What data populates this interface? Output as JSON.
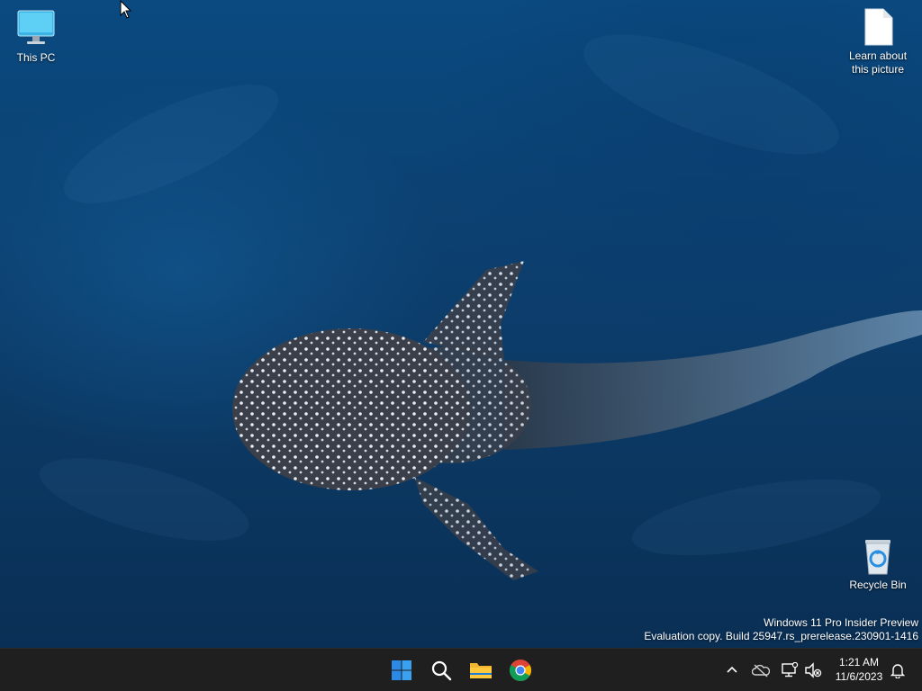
{
  "desktop": {
    "icons": [
      {
        "label": "This PC",
        "icon": "monitor-icon"
      },
      {
        "label": "Learn about this picture",
        "icon": "document-icon"
      },
      {
        "label": "Recycle Bin",
        "icon": "recycle-bin-icon"
      }
    ],
    "watermark": {
      "line1": "Windows 11 Pro Insider Preview",
      "line2": "Evaluation copy. Build 25947.rs_prerelease.230901-1416"
    }
  },
  "taskbar": {
    "apps": [
      {
        "name": "Start",
        "icon": "windows-start-icon"
      },
      {
        "name": "Search",
        "icon": "search-icon"
      },
      {
        "name": "File Explorer",
        "icon": "folder-icon"
      },
      {
        "name": "Google Chrome",
        "icon": "chrome-icon"
      }
    ],
    "tray": [
      {
        "icon": "chevron-up-icon"
      },
      {
        "icon": "onedrive-offline-icon"
      },
      {
        "icon": "network-icon"
      },
      {
        "icon": "volume-muted-icon"
      },
      {
        "icon": "notification-bell-icon"
      }
    ],
    "clock": {
      "time": "1:21 AM",
      "date": "11/6/2023"
    }
  },
  "colors": {
    "taskbar": "#1f1f1f",
    "wallpaper": "#0b3f6e",
    "start_blue": "#2b8ae6"
  }
}
